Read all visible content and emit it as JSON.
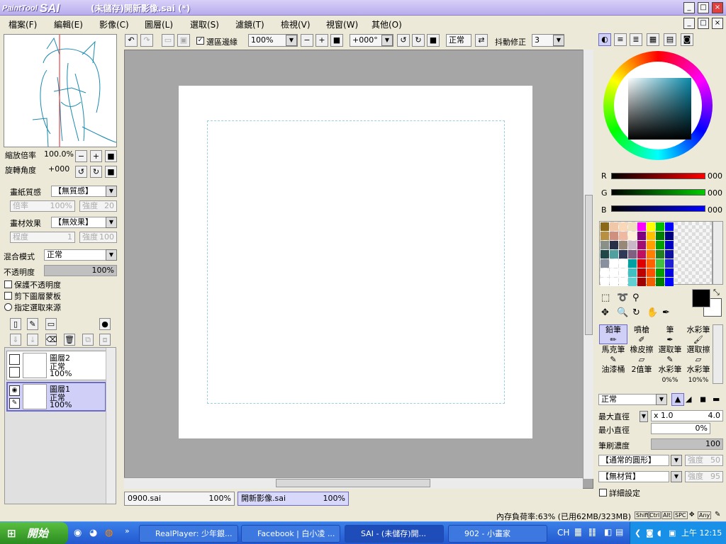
{
  "window": {
    "app_name": "PaintTool SAI",
    "logo_small": "PaintTool",
    "logo_big": "SAI",
    "title": "(未儲存)開新影像.sai (*)"
  },
  "menu": [
    "檔案(F)",
    "編輯(E)",
    "影像(C)",
    "圖層(L)",
    "選取(S)",
    "濾鏡(T)",
    "檢視(V)",
    "視窗(W)",
    "其他(O)"
  ],
  "toolbar": {
    "selection_edge_label": "選區邊緣",
    "selection_edge_checked": true,
    "zoom": "100%",
    "rotation": "+000°",
    "blend": "正常",
    "stabilizer_label": "抖動修正",
    "stabilizer_value": "3"
  },
  "navigator": {
    "zoom_label": "縮放倍率",
    "zoom_value": "100.0%",
    "rotate_label": "旋轉角度",
    "rotate_value": "+000"
  },
  "paper": {
    "texture_label": "畫紙質感",
    "texture_value": "【無質感】",
    "scale_label": "倍率",
    "scale_value": "100%",
    "strength_label": "強度",
    "strength_value": "20"
  },
  "effect": {
    "label": "畫材效果",
    "value": "【無效果】",
    "amount_label": "程度",
    "amount_value": "1",
    "strength_label": "強度",
    "strength_value": "100"
  },
  "layer_props": {
    "blend_label": "混合模式",
    "blend_value": "正常",
    "opacity_label": "不透明度",
    "opacity_value": "100%",
    "opacity": 1.0,
    "protect_alpha": "保護不透明度",
    "clip": "剪下圖層蒙板",
    "selection_source": "指定選取來源"
  },
  "layers": [
    {
      "name": "圖層2",
      "mode": "正常",
      "opacity": "100%",
      "selected": false
    },
    {
      "name": "圖層1",
      "mode": "正常",
      "opacity": "100%",
      "selected": true
    }
  ],
  "tabs": [
    {
      "name": "0900.sai",
      "zoom": "100%"
    },
    {
      "name": "開新影像.sai",
      "zoom": "100%"
    }
  ],
  "color": {
    "r_label": "R",
    "g_label": "G",
    "b_label": "B",
    "r": "000",
    "g": "000",
    "b": "000",
    "current": "#000000",
    "secondary": "#ffffff"
  },
  "palette": [
    "#8a6a18",
    "#f0c8a8",
    "#f8d8b8",
    "#f0e0c0",
    "#ff00ff",
    "#ffff00",
    "#00c000",
    "#0000ff",
    "#b89040",
    "#d09080",
    "#f0b8a0",
    "#fff0d8",
    "#800080",
    "#ffc000",
    "#008000",
    "#000080",
    "#889088",
    "#283048",
    "#988878",
    "#c8b8c8",
    "#a01070",
    "#ffa000",
    "#00a000",
    "#0000c0",
    "#204848",
    "#50a0a0",
    "#303858",
    "#806080",
    "#c01060",
    "#ff8000",
    "#208020",
    "#1010a0",
    "#8890a0",
    "#ffffff",
    "#ffffff",
    "#00a0a0",
    "#e00000",
    "#ff6000",
    "#40c040",
    "#2020d0",
    "#ffffff",
    "#ffffff",
    "#ffffff",
    "#40c0c0",
    "#c00000",
    "#ff5000",
    "#00a000",
    "#0000e0",
    "#ffffff",
    "#ffffff",
    "#ffffff",
    "#60d0d0",
    "#a00000",
    "#f06000",
    "#008000",
    "#0000ff"
  ],
  "tools": [
    "鉛筆",
    "噴槍",
    "筆",
    "水彩筆",
    "馬克筆",
    "橡皮擦",
    "選取筆",
    "選取擦",
    "油漆桶",
    "2值筆",
    "水彩筆",
    "水彩筆"
  ],
  "tool_sub": [
    "",
    "",
    "",
    "",
    "",
    "",
    "",
    "",
    "",
    "",
    "0%%",
    "10%%"
  ],
  "brush": {
    "mode": "正常",
    "max_size_label": "最大直徑",
    "max_size_mult": "x 1.0",
    "max_size_value": "4.0",
    "min_size_label": "最小直徑",
    "min_size_value": "0%",
    "density_label": "筆刷濃度",
    "density_value": "100",
    "shape": "【通常的圓形】",
    "shape_strength_label": "強度",
    "shape_strength": "50",
    "texture": "【無材質】",
    "texture_strength_label": "強度",
    "texture_strength": "95",
    "details": "詳細設定"
  },
  "status": {
    "memory": "內存負荷率:63% (已用62MB/323MB)",
    "keys": [
      "Shift",
      "Ctrl",
      "Alt",
      "SPC",
      "Any"
    ]
  },
  "taskbar": {
    "start": "開始",
    "items": [
      "RealPlayer: 少年銀...",
      "Facebook | 白小凌 ...",
      "SAI - (未儲存)開...",
      "902 - 小畫家"
    ],
    "lang": "CH",
    "clock": "上午 12:15"
  }
}
